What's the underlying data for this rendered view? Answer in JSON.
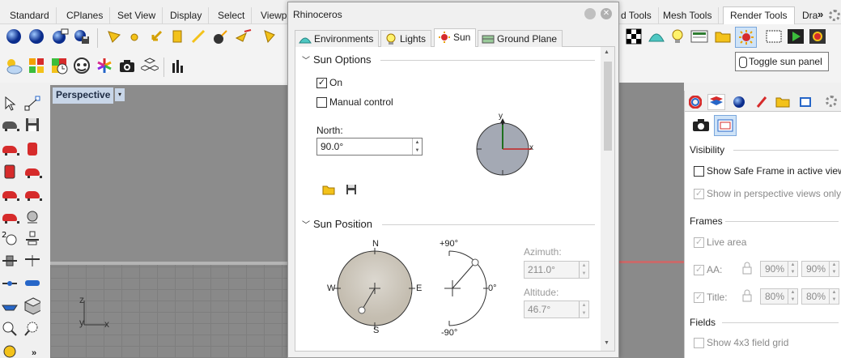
{
  "top_tabs": [
    {
      "label": "Standard"
    },
    {
      "label": "CPlanes"
    },
    {
      "label": "Set View"
    },
    {
      "label": "Display"
    },
    {
      "label": "Select"
    },
    {
      "label": "Viewp"
    },
    {
      "label": "d Tools"
    },
    {
      "label": "Mesh Tools"
    },
    {
      "label": "Render Tools"
    },
    {
      "label": "Dra"
    }
  ],
  "more_glyph": "»",
  "tooltip": "Toggle sun panel",
  "viewport": {
    "title": "Perspective",
    "menu_arrow": "▾",
    "axis_z": "z",
    "axis_y": "y",
    "axis_x": "x"
  },
  "dialog": {
    "title": "Rhinoceros",
    "tabs": [
      {
        "label": "Environments"
      },
      {
        "label": "Lights"
      },
      {
        "label": "Sun"
      },
      {
        "label": "Ground Plane"
      }
    ],
    "sun_options": {
      "header": "Sun Options",
      "on_label": "On",
      "on_checked": true,
      "manual_label": "Manual control",
      "manual_checked": false,
      "north_label": "North:",
      "north_value": "90.0°",
      "compass_y": "y",
      "compass_x": "x"
    },
    "sun_position": {
      "header": "Sun Position",
      "n": "N",
      "s": "S",
      "e": "E",
      "w": "W",
      "alt_top": "+90°",
      "alt_mid": "0°",
      "alt_bottom": "-90°",
      "azimuth_label": "Azimuth:",
      "azimuth_value": "211.0°",
      "altitude_label": "Altitude:",
      "altitude_value": "46.7°"
    }
  },
  "right_panel": {
    "visibility_header": "Visibility",
    "safe_frame_label": "Show Safe Frame in active view",
    "safe_frame_checked": false,
    "perspective_label": "Show in perspective views only",
    "perspective_checked": true,
    "frames_header": "Frames",
    "live_area_label": "Live area",
    "live_area_checked": true,
    "aa_label": "AA:",
    "aa_checked": true,
    "aa_value1": "90%",
    "aa_value2": "90%",
    "title_label": "Title:",
    "title_checked": true,
    "title_value1": "80%",
    "title_value2": "80%",
    "fields_header": "Fields",
    "grid_label": "Show 4x3 field grid",
    "grid_checked": false
  },
  "check_glyph": "✓"
}
